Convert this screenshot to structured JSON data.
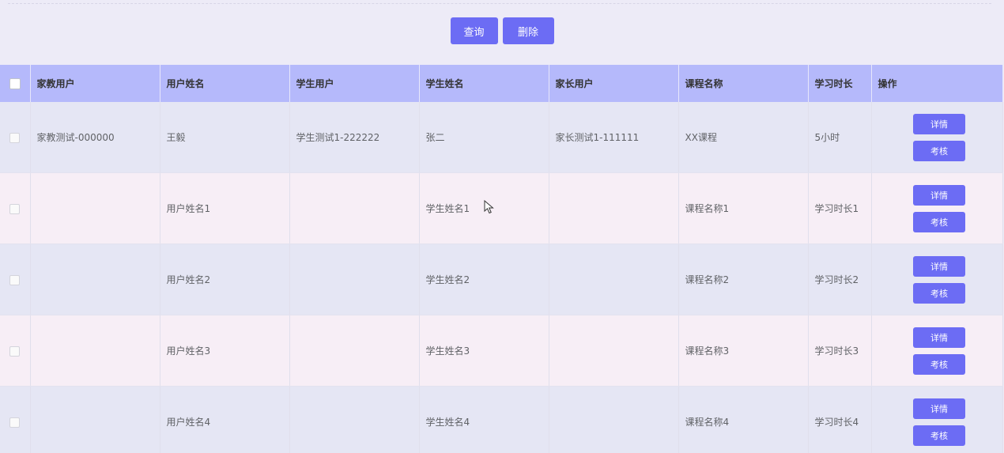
{
  "toolbar": {
    "query_label": "查询",
    "delete_label": "删除"
  },
  "table": {
    "headers": [
      "家教用户",
      "用户姓名",
      "学生用户",
      "学生姓名",
      "家长用户",
      "课程名称",
      "学习时长",
      "操作"
    ],
    "rows": [
      {
        "tutor_user": "家教测试-000000",
        "user_name": "王毅",
        "student_user": "学生测试1-222222",
        "student_name": "张二",
        "parent_user": "家长测试1-111111",
        "course_name": "XX课程",
        "study_duration": "5小时"
      },
      {
        "tutor_user": "",
        "user_name": "用户姓名1",
        "student_user": "",
        "student_name": "学生姓名1",
        "parent_user": "",
        "course_name": "课程名称1",
        "study_duration": "学习时长1"
      },
      {
        "tutor_user": "",
        "user_name": "用户姓名2",
        "student_user": "",
        "student_name": "学生姓名2",
        "parent_user": "",
        "course_name": "课程名称2",
        "study_duration": "学习时长2"
      },
      {
        "tutor_user": "",
        "user_name": "用户姓名3",
        "student_user": "",
        "student_name": "学生姓名3",
        "parent_user": "",
        "course_name": "课程名称3",
        "study_duration": "学习时长3"
      },
      {
        "tutor_user": "",
        "user_name": "用户姓名4",
        "student_user": "",
        "student_name": "学生姓名4",
        "parent_user": "",
        "course_name": "课程名称4",
        "study_duration": "学习时长4"
      }
    ],
    "row_actions": {
      "detail_label": "详情",
      "assess_label": "考核"
    }
  },
  "colors": {
    "accent": "#6c6cf4",
    "header_bg": "#b5b9fb",
    "row_odd": "#e5e6f4",
    "row_even": "#f7eef6",
    "page_bg": "#edebf7"
  }
}
